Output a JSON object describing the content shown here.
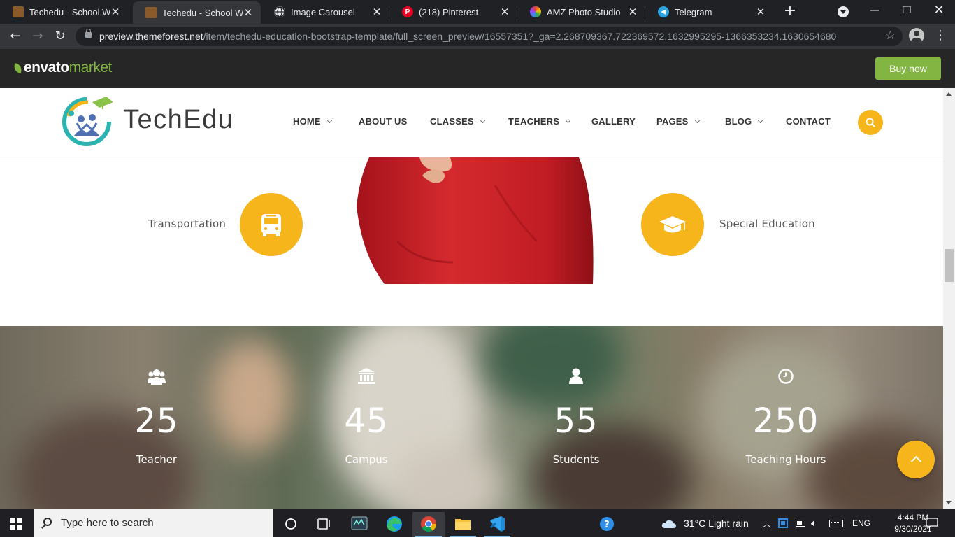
{
  "browser": {
    "tabs": [
      {
        "title": "Techedu - School Web",
        "favicon": "techedu-favicon",
        "active": false
      },
      {
        "title": "Techedu - School Web",
        "favicon": "techedu-favicon",
        "active": true
      },
      {
        "title": "Image Carousel",
        "favicon": "globe-favicon",
        "active": false
      },
      {
        "title": "(218) Pinterest",
        "favicon": "pinterest-favicon",
        "active": false
      },
      {
        "title": "AMZ Photo Studio",
        "favicon": "amz-favicon",
        "active": false
      },
      {
        "title": "Telegram",
        "favicon": "telegram-favicon",
        "active": false
      }
    ],
    "url_host": "preview.themeforest.net",
    "url_path": "/item/techedu-education-bootstrap-template/full_screen_preview/16557351?_ga=2.268709367.722369572.1632995295-1366353234.1630654680"
  },
  "envato": {
    "logo_word": "envato",
    "logo_market": "market",
    "buy_label": "Buy now",
    "brand_color": "#82b541"
  },
  "site": {
    "logo_text": "TechEdu",
    "accent_color": "#f5b51b",
    "menu": [
      {
        "label": "HOME",
        "dropdown": true
      },
      {
        "label": "ABOUT US",
        "dropdown": false
      },
      {
        "label": "CLASSES",
        "dropdown": true
      },
      {
        "label": "TEACHERS",
        "dropdown": true
      },
      {
        "label": "GALLERY",
        "dropdown": false
      },
      {
        "label": "PAGES",
        "dropdown": true
      },
      {
        "label": "BLOG",
        "dropdown": true
      },
      {
        "label": "CONTACT",
        "dropdown": false
      }
    ],
    "features": {
      "left": {
        "label": "Transportation",
        "icon": "bus-icon"
      },
      "right": {
        "label": "Special Education",
        "icon": "graduation-cap-icon"
      }
    },
    "counters": [
      {
        "value": "25",
        "label": "Teacher",
        "icon": "users-icon"
      },
      {
        "value": "45",
        "label": "Campus",
        "icon": "institution-icon"
      },
      {
        "value": "55",
        "label": "Students",
        "icon": "user-icon"
      },
      {
        "value": "250",
        "label": "Teaching Hours",
        "icon": "clock-icon"
      }
    ]
  },
  "taskbar": {
    "search_placeholder": "Type here to search",
    "weather": "31°C  Light rain",
    "language": "ENG",
    "time": "4:44 PM",
    "date": "9/30/2021"
  }
}
